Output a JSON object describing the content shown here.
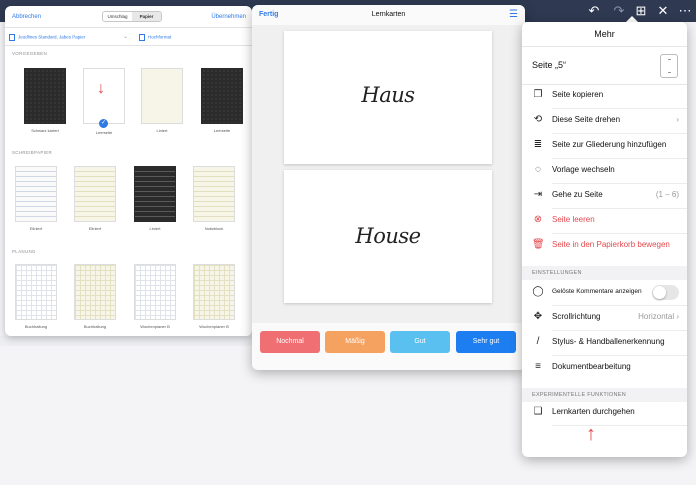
{
  "left": {
    "cancel": "Abbrechen",
    "accept": "Übernehmen",
    "seg_cover": "Umschlag",
    "seg_paper": "Papier",
    "sub_template": "Jeodlines Standard, Jabes Papier",
    "sub_format": "Hochformat",
    "section1": "VORGEGEBEN",
    "section2": "SCHREIBPAPIER",
    "section3": "PLANUNG",
    "row1": [
      "Schwarz kariert",
      "Leerseite",
      "Liniert",
      "Leerseite"
    ],
    "row2": [
      "Eliniert",
      "Eliniert",
      "Liniert",
      "Notizblock"
    ],
    "row3": [
      "Buchhaltung",
      "Buchhaltung",
      "Wochenplaner B",
      "Wochenplaner B"
    ]
  },
  "middle": {
    "done": "Fertig",
    "title": "Lernkarten",
    "card1": "Haus",
    "card2": "House",
    "rate_again": "Nochmal",
    "rate_hard": "Mäßig",
    "rate_good": "Gut",
    "rate_easy": "Sehr gut"
  },
  "right": {
    "title": "Mehr",
    "page": "Seite „5“",
    "items": [
      {
        "label": "Seite kopieren",
        "icon": "copy-icon"
      },
      {
        "label": "Diese Seite drehen",
        "icon": "rotate-icon"
      },
      {
        "label": "Seite zur Gliederung hinzufügen",
        "icon": "outline-icon"
      },
      {
        "label": "Vorlage wechseln",
        "icon": "template-icon"
      },
      {
        "label": "Gehe zu Seite",
        "icon": "goto-icon",
        "right": "(1 – 6)"
      },
      {
        "label": "Seite leeren",
        "icon": "clear-icon"
      },
      {
        "label": "Seite in den Papierkorb bewegen",
        "icon": "trash-icon"
      }
    ],
    "settings_header": "EINSTELLUNGEN",
    "settings": [
      {
        "label": "Gelöste Kommentare anzeigen"
      },
      {
        "label": "Scrollrichtung",
        "right": "Horizontal"
      },
      {
        "label": "Stylus- & Handballenerkennung"
      },
      {
        "label": "Dokumentbearbeitung"
      }
    ],
    "experimental_header": "EXPERIMENTELLE FUNKTIONEN",
    "flashcards": "Lernkarten durchgehen"
  },
  "colors": {
    "accent": "#2f7ae5",
    "danger": "#e5484d",
    "rate_again": "#ef6f72",
    "rate_hard": "#f5a261",
    "rate_good": "#5ac0f0",
    "rate_easy": "#1c7ef0"
  }
}
